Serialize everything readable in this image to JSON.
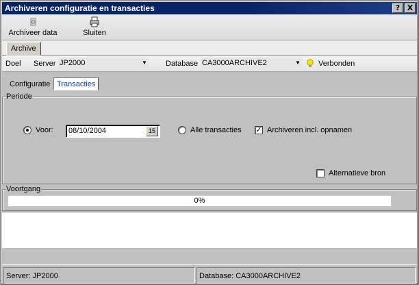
{
  "window": {
    "title": "Archiveren configuratie en transacties"
  },
  "titlebar_buttons": {
    "help": "?",
    "close": "X"
  },
  "toolbar": {
    "archive_label": "Archiveer data",
    "close_label": "Sluiten"
  },
  "top_tab": {
    "label": "Archive"
  },
  "target": {
    "doel_label": "Doel",
    "server_label": "Server",
    "server_value": "JP2000",
    "database_label": "Database",
    "database_value": "CA3000ARCHIVE2",
    "status_text": "Verbonden"
  },
  "subtabs": [
    {
      "label": "Configuratie",
      "active": false
    },
    {
      "label": "Transacties",
      "active": true
    }
  ],
  "periode": {
    "title": "Periode",
    "voor_label": "Voor:",
    "voor_selected": true,
    "date_value": "08/10/2004",
    "calendar_glyph": "15",
    "alle_label": "Alle transacties",
    "alle_selected": false,
    "archiveren_label": "Archiveren incl. opnamen",
    "archiveren_checked": true,
    "alt_bron_label": "Alternatieve bron",
    "alt_bron_checked": false
  },
  "voortgang": {
    "title": "Voortgang",
    "progress_text": "0%",
    "progress_value": 0
  },
  "statusbar": {
    "server_text": "Server: JP2000",
    "database_text": "Database: CA3000ARCHIVE2"
  },
  "icons": {
    "archive": "gear-icon",
    "close": "printer-icon",
    "status": "lightbulb-icon"
  }
}
